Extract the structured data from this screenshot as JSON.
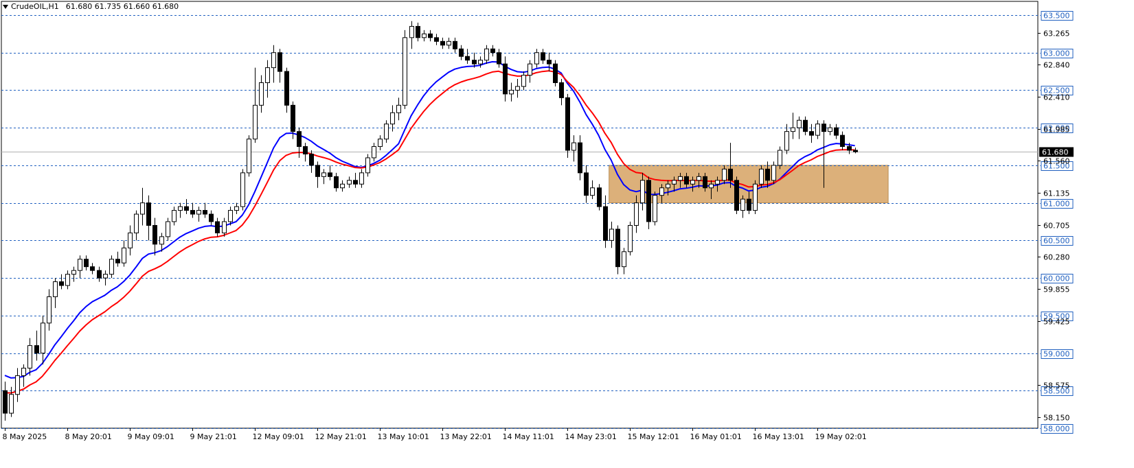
{
  "header": {
    "symbol": "CrudeOIL,H1",
    "ohlc": "61.680 61.735 61.660 61.680"
  },
  "colors": {
    "background": "#ffffff",
    "frame": "#000000",
    "grid": "#1f5fbf",
    "bull_body": "#ffffff",
    "bear_body": "#000000",
    "ma_fast": "#0000ff",
    "ma_slow": "#ff0000",
    "zone": "#dcb07a",
    "current_price_line": "#b0b0b0",
    "current_price_badge": "#000000"
  },
  "chart_data": {
    "type": "candlestick",
    "ylim": [
      58.0,
      63.63
    ],
    "price_ticks": [
      "58.150",
      "58.575",
      "59.425",
      "59.855",
      "60.280",
      "60.705",
      "61.135",
      "61.560",
      "61.985",
      "62.410",
      "62.840",
      "63.265"
    ],
    "grid_levels": [
      "58.000",
      "58.500",
      "59.000",
      "59.500",
      "60.000",
      "60.500",
      "61.000",
      "61.500",
      "62.000",
      "62.500",
      "63.000",
      "63.500"
    ],
    "current_price": "61.680",
    "zone": {
      "from_bar": 97,
      "to_bar": 141,
      "low": 61.0,
      "high": 61.5
    },
    "time_labels": [
      {
        "bar": 0,
        "label": "8 May 2025"
      },
      {
        "bar": 10,
        "label": "8 May 20:01"
      },
      {
        "bar": 20,
        "label": "9 May 09:01"
      },
      {
        "bar": 30,
        "label": "9 May 21:01"
      },
      {
        "bar": 40,
        "label": "12 May 09:01"
      },
      {
        "bar": 50,
        "label": "12 May 21:01"
      },
      {
        "bar": 60,
        "label": "13 May 10:01"
      },
      {
        "bar": 70,
        "label": "13 May 22:01"
      },
      {
        "bar": 80,
        "label": "14 May 11:01"
      },
      {
        "bar": 90,
        "label": "14 May 23:01"
      },
      {
        "bar": 100,
        "label": "15 May 12:01"
      },
      {
        "bar": 110,
        "label": "16 May 01:01"
      },
      {
        "bar": 120,
        "label": "16 May 13:01"
      },
      {
        "bar": 130,
        "label": "19 May 02:01"
      }
    ],
    "candles": [
      [
        58.5,
        58.62,
        58.1,
        58.2
      ],
      [
        58.2,
        58.55,
        58.15,
        58.45
      ],
      [
        58.45,
        58.8,
        58.35,
        58.7
      ],
      [
        58.7,
        58.85,
        58.55,
        58.8
      ],
      [
        58.8,
        59.2,
        58.7,
        59.1
      ],
      [
        59.1,
        59.3,
        58.9,
        59.0
      ],
      [
        59.0,
        59.5,
        58.85,
        59.4
      ],
      [
        59.4,
        59.85,
        59.3,
        59.75
      ],
      [
        59.75,
        60.0,
        59.6,
        59.95
      ],
      [
        59.95,
        60.05,
        59.85,
        59.9
      ],
      [
        59.9,
        60.1,
        59.85,
        60.05
      ],
      [
        60.05,
        60.15,
        59.95,
        60.1
      ],
      [
        60.1,
        60.3,
        60.0,
        60.25
      ],
      [
        60.25,
        60.3,
        60.1,
        60.15
      ],
      [
        60.15,
        60.2,
        60.05,
        60.1
      ],
      [
        60.1,
        60.15,
        59.95,
        60.0
      ],
      [
        60.0,
        60.1,
        59.9,
        60.05
      ],
      [
        60.05,
        60.3,
        60.0,
        60.25
      ],
      [
        60.25,
        60.35,
        60.15,
        60.2
      ],
      [
        60.2,
        60.5,
        60.15,
        60.4
      ],
      [
        60.4,
        60.7,
        60.3,
        60.6
      ],
      [
        60.6,
        60.9,
        60.5,
        60.85
      ],
      [
        60.85,
        61.2,
        60.7,
        61.0
      ],
      [
        61.0,
        61.1,
        60.5,
        60.7
      ],
      [
        60.7,
        60.8,
        60.3,
        60.45
      ],
      [
        60.45,
        60.6,
        60.35,
        60.55
      ],
      [
        60.55,
        60.8,
        60.5,
        60.75
      ],
      [
        60.75,
        60.95,
        60.7,
        60.9
      ],
      [
        60.9,
        61.0,
        60.8,
        60.95
      ],
      [
        60.95,
        61.05,
        60.85,
        60.9
      ],
      [
        60.9,
        61.0,
        60.8,
        60.85
      ],
      [
        60.85,
        60.95,
        60.75,
        60.9
      ],
      [
        60.9,
        61.0,
        60.8,
        60.85
      ],
      [
        60.85,
        60.9,
        60.7,
        60.75
      ],
      [
        60.75,
        60.8,
        60.55,
        60.6
      ],
      [
        60.6,
        60.8,
        60.55,
        60.75
      ],
      [
        60.75,
        60.95,
        60.7,
        60.9
      ],
      [
        60.9,
        61.0,
        60.85,
        60.95
      ],
      [
        60.95,
        61.45,
        60.9,
        61.4
      ],
      [
        61.4,
        61.9,
        61.35,
        61.85
      ],
      [
        61.85,
        62.8,
        61.8,
        62.3
      ],
      [
        62.3,
        62.7,
        62.2,
        62.6
      ],
      [
        62.6,
        62.9,
        62.4,
        62.8
      ],
      [
        62.8,
        63.1,
        62.6,
        63.0
      ],
      [
        63.0,
        63.05,
        62.6,
        62.75
      ],
      [
        62.75,
        62.8,
        62.2,
        62.3
      ],
      [
        62.3,
        62.35,
        61.85,
        61.95
      ],
      [
        61.95,
        62.0,
        61.6,
        61.75
      ],
      [
        61.75,
        61.8,
        61.55,
        61.65
      ],
      [
        61.65,
        61.7,
        61.4,
        61.5
      ],
      [
        61.5,
        61.55,
        61.2,
        61.35
      ],
      [
        61.35,
        61.45,
        61.25,
        61.4
      ],
      [
        61.4,
        61.5,
        61.3,
        61.35
      ],
      [
        61.35,
        61.4,
        61.15,
        61.2
      ],
      [
        61.2,
        61.3,
        61.15,
        61.25
      ],
      [
        61.25,
        61.35,
        61.2,
        61.3
      ],
      [
        61.3,
        61.4,
        61.2,
        61.25
      ],
      [
        61.25,
        61.45,
        61.2,
        61.4
      ],
      [
        61.4,
        61.65,
        61.35,
        61.6
      ],
      [
        61.6,
        61.8,
        61.55,
        61.75
      ],
      [
        61.75,
        61.9,
        61.7,
        61.85
      ],
      [
        61.85,
        62.1,
        61.8,
        62.05
      ],
      [
        62.05,
        62.3,
        61.95,
        62.2
      ],
      [
        62.2,
        62.4,
        62.1,
        62.3
      ],
      [
        62.3,
        63.3,
        62.25,
        63.2
      ],
      [
        63.2,
        63.42,
        63.05,
        63.35
      ],
      [
        63.35,
        63.4,
        63.15,
        63.2
      ],
      [
        63.2,
        63.3,
        63.15,
        63.25
      ],
      [
        63.25,
        63.3,
        63.15,
        63.2
      ],
      [
        63.2,
        63.25,
        63.1,
        63.15
      ],
      [
        63.15,
        63.2,
        63.05,
        63.1
      ],
      [
        63.1,
        63.2,
        63.05,
        63.15
      ],
      [
        63.15,
        63.2,
        63.0,
        63.05
      ],
      [
        63.05,
        63.1,
        62.9,
        62.95
      ],
      [
        62.95,
        63.05,
        62.85,
        62.9
      ],
      [
        62.9,
        63.0,
        62.8,
        62.85
      ],
      [
        62.85,
        62.95,
        62.8,
        62.9
      ],
      [
        62.9,
        63.1,
        62.85,
        63.05
      ],
      [
        63.05,
        63.1,
        62.95,
        63.0
      ],
      [
        63.0,
        63.05,
        62.8,
        62.85
      ],
      [
        62.85,
        62.95,
        62.35,
        62.45
      ],
      [
        62.45,
        62.6,
        62.35,
        62.5
      ],
      [
        62.5,
        62.65,
        62.4,
        62.55
      ],
      [
        62.55,
        62.75,
        62.5,
        62.7
      ],
      [
        62.7,
        62.9,
        62.6,
        62.85
      ],
      [
        62.85,
        63.05,
        62.8,
        63.0
      ],
      [
        63.0,
        63.05,
        62.85,
        62.9
      ],
      [
        62.9,
        63.0,
        62.75,
        62.85
      ],
      [
        62.85,
        62.9,
        62.55,
        62.6
      ],
      [
        62.6,
        62.65,
        62.3,
        62.4
      ],
      [
        62.4,
        62.45,
        61.6,
        61.7
      ],
      [
        61.7,
        61.9,
        61.55,
        61.8
      ],
      [
        61.8,
        61.9,
        61.3,
        61.4
      ],
      [
        61.4,
        61.5,
        61.0,
        61.1
      ],
      [
        61.1,
        61.3,
        61.05,
        61.2
      ],
      [
        61.2,
        61.25,
        60.9,
        60.95
      ],
      [
        60.95,
        61.1,
        60.4,
        60.5
      ],
      [
        60.5,
        60.75,
        60.4,
        60.65
      ],
      [
        60.65,
        60.7,
        60.05,
        60.15
      ],
      [
        60.15,
        60.4,
        60.05,
        60.35
      ],
      [
        60.35,
        60.75,
        60.3,
        60.7
      ],
      [
        60.7,
        61.1,
        60.6,
        61.0
      ],
      [
        61.0,
        61.4,
        60.9,
        61.3
      ],
      [
        61.3,
        61.35,
        60.65,
        60.75
      ],
      [
        60.75,
        61.15,
        60.7,
        61.1
      ],
      [
        61.1,
        61.25,
        61.0,
        61.2
      ],
      [
        61.2,
        61.3,
        61.1,
        61.25
      ],
      [
        61.25,
        61.35,
        61.15,
        61.3
      ],
      [
        61.3,
        61.4,
        61.2,
        61.35
      ],
      [
        61.35,
        61.4,
        61.2,
        61.25
      ],
      [
        61.25,
        61.35,
        61.15,
        61.3
      ],
      [
        61.3,
        61.4,
        61.2,
        61.35
      ],
      [
        61.35,
        61.4,
        61.15,
        61.2
      ],
      [
        61.2,
        61.3,
        61.05,
        61.25
      ],
      [
        61.25,
        61.35,
        61.15,
        61.3
      ],
      [
        61.3,
        61.5,
        61.25,
        61.45
      ],
      [
        61.45,
        61.8,
        61.2,
        61.3
      ],
      [
        61.3,
        61.35,
        60.85,
        60.9
      ],
      [
        60.9,
        61.1,
        60.8,
        61.05
      ],
      [
        61.05,
        61.15,
        60.85,
        60.9
      ],
      [
        60.9,
        61.3,
        60.85,
        61.25
      ],
      [
        61.25,
        61.5,
        61.2,
        61.45
      ],
      [
        61.45,
        61.55,
        61.2,
        61.3
      ],
      [
        61.3,
        61.55,
        61.25,
        61.5
      ],
      [
        61.5,
        61.75,
        61.45,
        61.7
      ],
      [
        61.7,
        62.05,
        61.65,
        61.95
      ],
      [
        61.95,
        62.2,
        61.85,
        62.0
      ],
      [
        62.0,
        62.15,
        61.85,
        62.1
      ],
      [
        62.1,
        62.15,
        61.9,
        61.95
      ],
      [
        61.95,
        62.05,
        61.8,
        61.9
      ],
      [
        61.9,
        62.1,
        61.85,
        62.05
      ],
      [
        62.05,
        62.1,
        61.2,
        61.95
      ],
      [
        61.95,
        62.05,
        61.9,
        62.0
      ],
      [
        62.0,
        62.05,
        61.85,
        61.9
      ],
      [
        61.9,
        61.95,
        61.7,
        61.75
      ],
      [
        61.75,
        61.8,
        61.65,
        61.7
      ],
      [
        61.7,
        61.735,
        61.66,
        61.68
      ]
    ],
    "series": [
      {
        "color": "#0000ff"
      },
      {
        "color": "#ff0000"
      }
    ]
  }
}
